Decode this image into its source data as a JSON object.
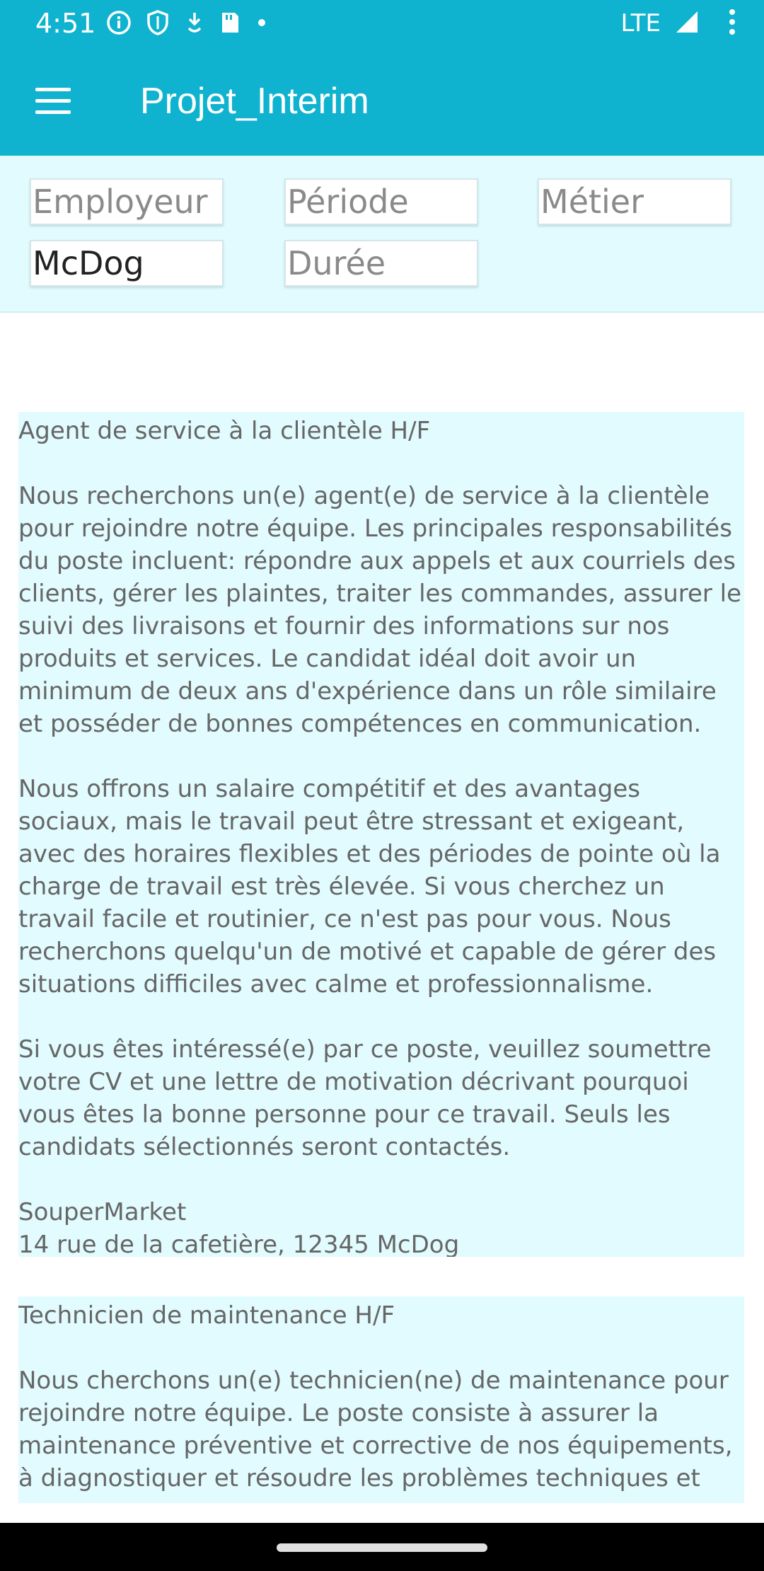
{
  "status_bar": {
    "time": "4:51",
    "network": "LTE",
    "icons": [
      "info-icon",
      "shield-icon",
      "download-icon",
      "sd-card-icon",
      "dot-icon",
      "signal-icon",
      "overflow-icon"
    ]
  },
  "app_bar": {
    "title": "Projet_Interim",
    "menu_icon": "hamburger-menu-icon"
  },
  "filters": {
    "employeur": {
      "placeholder": "Employeur",
      "value": ""
    },
    "periode": {
      "placeholder": "Période",
      "value": ""
    },
    "metier": {
      "placeholder": "Métier",
      "value": ""
    },
    "ville": {
      "placeholder": "",
      "value": "McDog"
    },
    "duree": {
      "placeholder": "Durée",
      "value": ""
    }
  },
  "offers": [
    {
      "title": "Agent de service à la clientèle H/F",
      "body": "Nous recherchons un(e) agent(e) de service à la clientèle pour rejoindre notre équipe. Les principales responsabilités du poste incluent: répondre aux appels et aux courriels des clients, gérer les plaintes, traiter les commandes, assurer le suivi des livraisons et fournir des informations sur nos produits et services. Le candidat idéal doit avoir un minimum de deux ans d'expérience dans un rôle similaire et posséder de bonnes compétences en communication.\n\nNous offrons un salaire compétitif et des avantages sociaux, mais le travail peut être stressant et exigeant, avec des horaires flexibles et des périodes de pointe où la charge de travail est très élevée. Si vous cherchez un travail facile et routinier, ce n'est pas pour vous. Nous recherchons quelqu'un de motivé et capable de gérer des situations difficiles avec calme et professionnalisme.\n\nSi vous êtes intéressé(e) par ce poste, veuillez soumettre votre CV et une lettre de motivation décrivant pourquoi vous êtes la bonne personne pour ce travail. Seuls les candidats sélectionnés seront contactés.",
      "company": "SouperMarket",
      "address": "14 rue de la cafetière, 12345 McDog"
    },
    {
      "title": "Technicien de maintenance H/F",
      "body": "Nous cherchons un(e) technicien(ne) de maintenance pour rejoindre notre équipe. Le poste consiste à assurer la maintenance préventive et corrective de nos équipements, à diagnostiquer et résoudre les problèmes techniques et"
    }
  ]
}
